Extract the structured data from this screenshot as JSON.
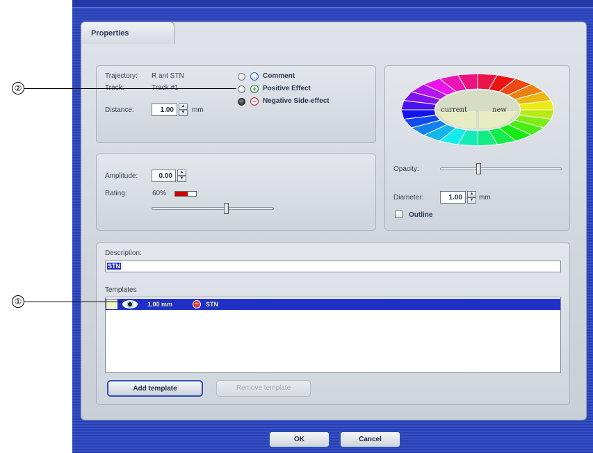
{
  "dialog": {
    "tab_title": "Properties"
  },
  "track_group": {
    "trajectory_label": "Trajectory:",
    "trajectory_value": "R ant STN",
    "track_label": "Track:",
    "track_value": "Track #1",
    "distance_label": "Distance:",
    "distance_value": "1.00",
    "distance_unit": "mm",
    "effect_options": [
      {
        "label": "Comment",
        "selected": false,
        "icon": "comment-icon",
        "symbol": "…"
      },
      {
        "label": "Positive Effect",
        "selected": false,
        "icon": "plus-icon",
        "symbol": "+"
      },
      {
        "label": "Negative Side-effect",
        "selected": true,
        "icon": "minus-icon",
        "symbol": "−"
      }
    ]
  },
  "amplitude_group": {
    "amplitude_label": "Amplitude:",
    "amplitude_value": "0.00",
    "rating_label": "Rating:",
    "rating_value": "60%",
    "rating_fraction": 0.6
  },
  "color_group": {
    "current_label": "current",
    "new_label": "new",
    "opacity_label": "Opacity:",
    "diameter_label": "Diameter:",
    "diameter_value": "1.00",
    "diameter_unit": "mm",
    "outline_label": "Outline",
    "outline_checked": false
  },
  "description_group": {
    "description_label": "Description:",
    "description_value": "STN",
    "templates_label": "Templates",
    "templates": [
      {
        "distance": "1.00 mm",
        "name": "STN",
        "selected": true
      }
    ],
    "add_template_label": "Add template",
    "remove_template_label": "Remove template"
  },
  "footer": {
    "ok_label": "OK",
    "cancel_label": "Cancel"
  },
  "callouts": {
    "one": "①",
    "two": "②"
  },
  "colors": {
    "selection_blue": "#1f2fc8",
    "accent_border": "#2b4fb8",
    "rating_red": "#cc0000"
  }
}
